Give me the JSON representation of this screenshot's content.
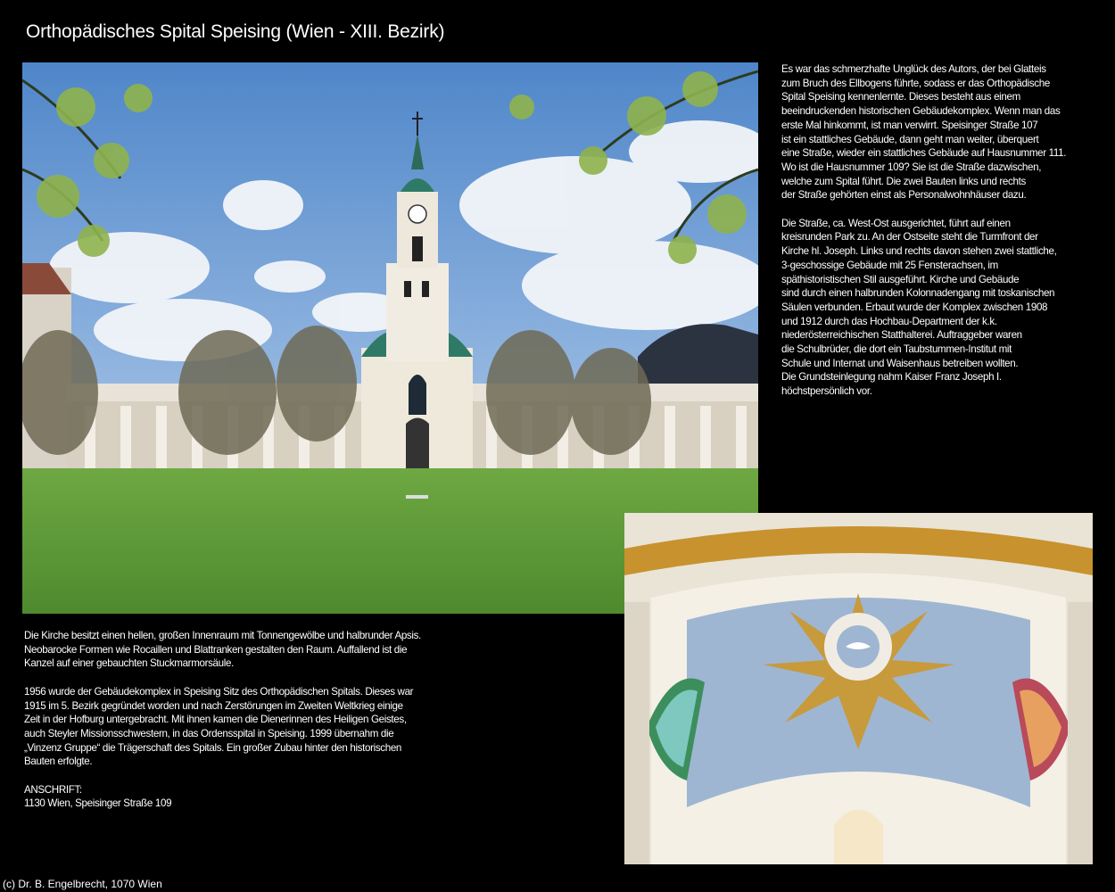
{
  "page": {
    "title": "Orthopädisches Spital Speising (Wien - XIII. Bezirk)"
  },
  "right_text": {
    "p1": "Es war das schmerzhafte Unglück des Autors, der bei Glatteis\nzum Bruch des Ellbogens führte, sodass er das Orthopädische\nSpital Speising kennenlernte. Dieses besteht aus einem\nbeeindruckenden historischen Gebäudekomplex. Wenn man das\nerste Mal hinkommt, ist man verwirrt. Speisinger Straße 107\nist ein stattliches Gebäude, dann geht man weiter, überquert\neine Straße, wieder ein stattliches Gebäude auf Hausnummer 111.\nWo ist die Hausnummer 109? Sie ist die Straße dazwischen,\nwelche zum Spital führt. Die zwei Bauten links und rechts\nder Straße gehörten einst als Personalwohnhäuser dazu.",
    "p2": "Die Straße, ca. West-Ost ausgerichtet, führt auf einen\nkreisrunden Park zu. An der Ostseite steht die Turmfront der\nKirche hl. Joseph. Links und rechts davon stehen zwei stattliche,\n3-geschossige Gebäude mit 25 Fensterachsen, im\nspäthistoristischen Stil ausgeführt. Kirche und Gebäude\nsind durch einen halbrunden Kolonnadengang mit toskanischen\nSäulen verbunden. Erbaut wurde der Komplex zwischen 1908\nund 1912 durch das Hochbau-Department der k.k.\nniederösterreichischen Statthalterei. Auftraggeber waren\ndie Schulbrüder, die dort ein Taubstummen-Institut mit\nSchule und Internat und Waisenhaus betreiben wollten.\nDie Grundsteinlegung nahm Kaiser Franz Joseph I.\nhöchstpersönlich vor."
  },
  "left_text": {
    "p1": "Die Kirche besitzt einen hellen, großen Innenraum mit Tonnengewölbe und halbrunder Apsis.\nNeobarocke Formen wie Rocaillen und Blattranken gestalten den Raum. Auffallend ist die\nKanzel auf einer gebauchten Stuckmarmorsäule.",
    "p2": "1956 wurde der Gebäudekomplex in Speising Sitz des Orthopädischen Spitals. Dieses war\n1915 im 5. Bezirk gegründet worden und nach Zerstörungen im Zweiten Weltkrieg einige\nZeit in der Hofburg untergebracht. Mit ihnen kamen die Dienerinnen des Heiligen Geistes,\nauch Steyler Missionsschwestern, in das Ordensspital in Speising. 1999 übernahm die\n„Vinzenz Gruppe“ die Trägerschaft des Spitals. Ein großer Zubau hinter den historischen\nBauten erfolgte.",
    "p3": "ANSCHRIFT:\n1130 Wien, Speisinger Straße 109"
  },
  "footer": {
    "copyright": "(c) Dr. B. Engelbrecht, 1070 Wien"
  },
  "colors": {
    "background": "#000000",
    "text": "#ffffff",
    "sky": "#6f9fd6",
    "lawn": "#5f9a37",
    "dome_blue": "#9fb6d2",
    "gold": "#c79a3c"
  }
}
